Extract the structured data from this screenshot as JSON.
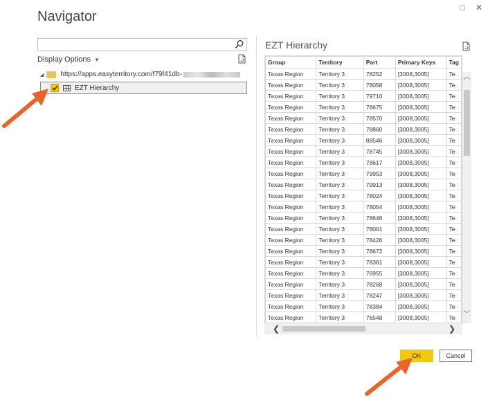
{
  "window": {
    "title": "Navigator",
    "maximize_icon": "□",
    "close_icon": "✕"
  },
  "left_pane": {
    "search_placeholder": "",
    "display_options_label": "Display Options",
    "tree": {
      "root_label": "https://apps.easyterritory.com/f79f41db-",
      "item_label": "EZT Hierarchy",
      "item_checked": true
    }
  },
  "preview": {
    "title": "EZT Hierarchy",
    "columns": [
      "Group",
      "Territory",
      "Part",
      "Primary Keys",
      "Tag"
    ],
    "rows": [
      [
        "Texas Region",
        "Territory 3",
        "78252",
        "[3008,3005]",
        "Te"
      ],
      [
        "Texas Region",
        "Territory 3",
        "78058",
        "[3008,3005]",
        "Te"
      ],
      [
        "Texas Region",
        "Territory 3",
        "79710",
        "[3008,3005]",
        "Te"
      ],
      [
        "Texas Region",
        "Territory 3",
        "78675",
        "[3008,3005]",
        "Te"
      ],
      [
        "Texas Region",
        "Territory 3",
        "78570",
        "[3008,3005]",
        "Te"
      ],
      [
        "Texas Region",
        "Territory 3",
        "78860",
        "[3008,3005]",
        "Te"
      ],
      [
        "Texas Region",
        "Territory 3",
        "88546",
        "[3008,3005]",
        "Te"
      ],
      [
        "Texas Region",
        "Territory 3",
        "78745",
        "[3008,3005]",
        "Te"
      ],
      [
        "Texas Region",
        "Territory 3",
        "78617",
        "[3008,3005]",
        "Te"
      ],
      [
        "Texas Region",
        "Territory 3",
        "79953",
        "[3008,3005]",
        "Te"
      ],
      [
        "Texas Region",
        "Territory 3",
        "79913",
        "[3008,3005]",
        "Te"
      ],
      [
        "Texas Region",
        "Territory 3",
        "78024",
        "[3008,3005]",
        "Te"
      ],
      [
        "Texas Region",
        "Territory 3",
        "78054",
        "[3008,3005]",
        "Te"
      ],
      [
        "Texas Region",
        "Territory 3",
        "78646",
        "[3008,3005]",
        "Te"
      ],
      [
        "Texas Region",
        "Territory 3",
        "78001",
        "[3008,3005]",
        "Te"
      ],
      [
        "Texas Region",
        "Territory 3",
        "78426",
        "[3008,3005]",
        "Te"
      ],
      [
        "Texas Region",
        "Territory 3",
        "78672",
        "[3008,3005]",
        "Te"
      ],
      [
        "Texas Region",
        "Territory 3",
        "78361",
        "[3008,3005]",
        "Te"
      ],
      [
        "Texas Region",
        "Territory 3",
        "76955",
        "[3008,3005]",
        "Te"
      ],
      [
        "Texas Region",
        "Territory 3",
        "78268",
        "[3008,3005]",
        "Te"
      ],
      [
        "Texas Region",
        "Territory 3",
        "78247",
        "[3008,3005]",
        "Te"
      ],
      [
        "Texas Region",
        "Territory 3",
        "78384",
        "[3008,3005]",
        "Te"
      ],
      [
        "Texas Region",
        "Territory 3",
        "76548",
        "[3008,3005]",
        "Te"
      ]
    ]
  },
  "footer": {
    "ok_label": "OK",
    "cancel_label": "Cancel"
  },
  "colors": {
    "accent": "#f2c811",
    "annotation_arrow": "#e8642a"
  },
  "icons": [
    "search-icon",
    "refresh-doc-icon",
    "folder-icon",
    "table-icon",
    "checkmark-icon",
    "chevron-down-icon",
    "scroll-up-icon",
    "scroll-down-icon",
    "scroll-left-icon",
    "scroll-right-icon",
    "maximize-icon",
    "close-icon"
  ]
}
